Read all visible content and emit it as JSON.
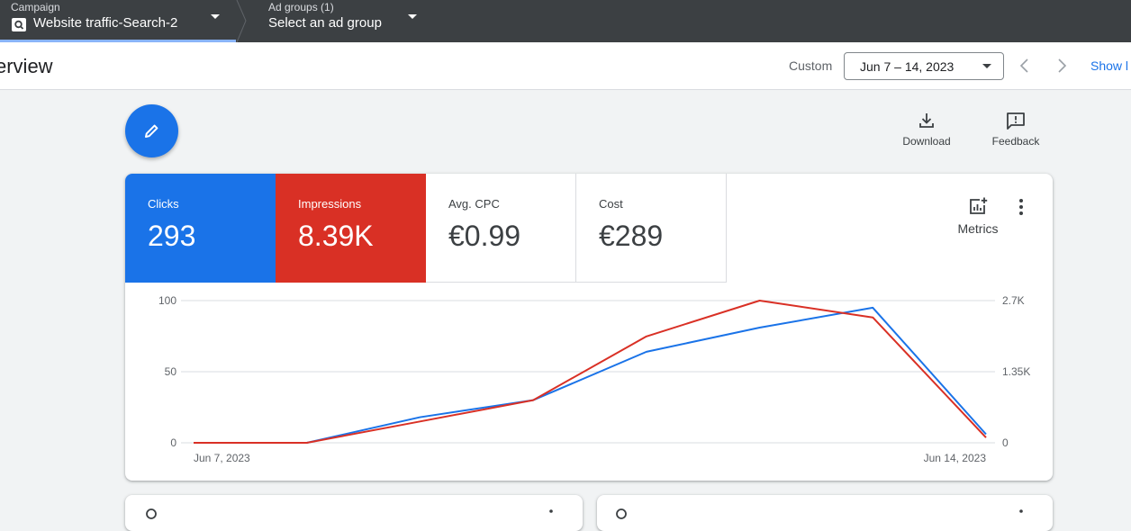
{
  "topbar": {
    "campaign_label": "Campaign",
    "campaign_value": "Website traffic-Search-2",
    "adgroup_label": "Ad groups (1)",
    "adgroup_value": "Select an ad group"
  },
  "header": {
    "title": "erview",
    "range_label": "Custom",
    "date_range": "Jun 7 – 14, 2023",
    "show_link": "Show l"
  },
  "tools": {
    "download": "Download",
    "feedback": "Feedback"
  },
  "metrics": [
    {
      "label": "Clicks",
      "value": "293",
      "color": "#1a73e8"
    },
    {
      "label": "Impressions",
      "value": "8.39K",
      "color": "#d93025"
    },
    {
      "label": "Avg. CPC",
      "value": "€0.99"
    },
    {
      "label": "Cost",
      "value": "€289"
    }
  ],
  "metrics_button": "Metrics",
  "chart_data": {
    "type": "line",
    "x": [
      "Jun 7",
      "Jun 8",
      "Jun 9",
      "Jun 10",
      "Jun 11",
      "Jun 12",
      "Jun 13",
      "Jun 14"
    ],
    "x_tick_labels": [
      "Jun 7, 2023",
      "Jun 14, 2023"
    ],
    "y_left_ticks": [
      "0",
      "50",
      "100"
    ],
    "y_right_ticks": [
      "0",
      "1.35K",
      "2.7K"
    ],
    "ylim_left": [
      0,
      100
    ],
    "ylim_right": [
      0,
      2700
    ],
    "grid": true,
    "series": [
      {
        "name": "Clicks",
        "axis": "left",
        "color": "#1a73e8",
        "values": [
          0,
          0,
          18,
          30,
          64,
          81,
          95,
          6
        ]
      },
      {
        "name": "Impressions",
        "axis": "right",
        "color": "#d93025",
        "values": [
          0,
          0,
          405,
          810,
          2020,
          2700,
          2380,
          100
        ]
      }
    ]
  }
}
